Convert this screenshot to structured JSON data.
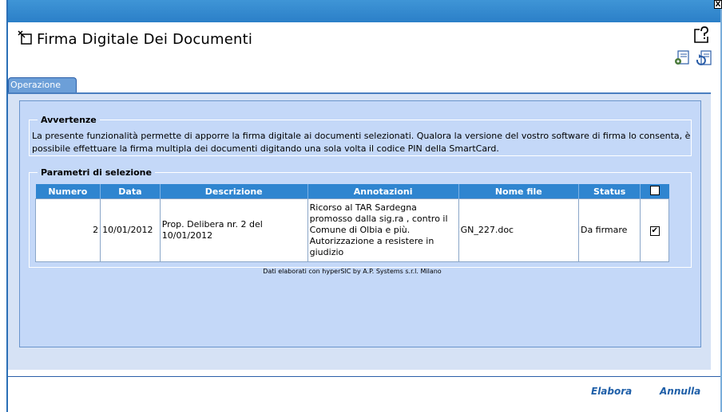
{
  "window": {
    "title": "Firma Digitale Dei Documenti",
    "close_glyph": "X"
  },
  "icons": {
    "window": "pin-window-icon",
    "help": "help-icon",
    "settings": "settings-icon",
    "refresh": "refresh-icon"
  },
  "tab": {
    "label": "Operazione"
  },
  "warnings": {
    "legend": "Avvertenze",
    "text": "La presente funzionalità permette di apporre la firma digitale ai documenti selezionati. Qualora la versione del vostro software di firma lo consenta, è possibile effettuare la firma multipla dei documenti digitando una sola volta il codice PIN della SmartCard."
  },
  "params": {
    "legend": "Parametri di selezione"
  },
  "table": {
    "headers": [
      "Numero",
      "Data",
      "Descrizione",
      "Annotazioni",
      "Nome file",
      "Status"
    ],
    "rows": [
      {
        "numero": "2",
        "data": "10/01/2012",
        "descrizione": "Prop. Delibera nr. 2 del 10/01/2012",
        "annotazioni": "Ricorso al TAR Sardegna promosso dalla sig.ra , contro il Comune di Olbia e più. Autorizzazione a resistere in giudizio",
        "nome_file": "GN_227.doc",
        "status": "Da firmare",
        "checked": true
      }
    ]
  },
  "credit": "Dati elaborati con hyperSIC by A.P. Systems s.r.l. Milano",
  "footer": {
    "elabora": "Elabora",
    "annulla": "Annulla"
  },
  "colors": {
    "header_blue": "#2f85d0",
    "panel": "#c4d8f8",
    "link": "#1f5fa8"
  }
}
